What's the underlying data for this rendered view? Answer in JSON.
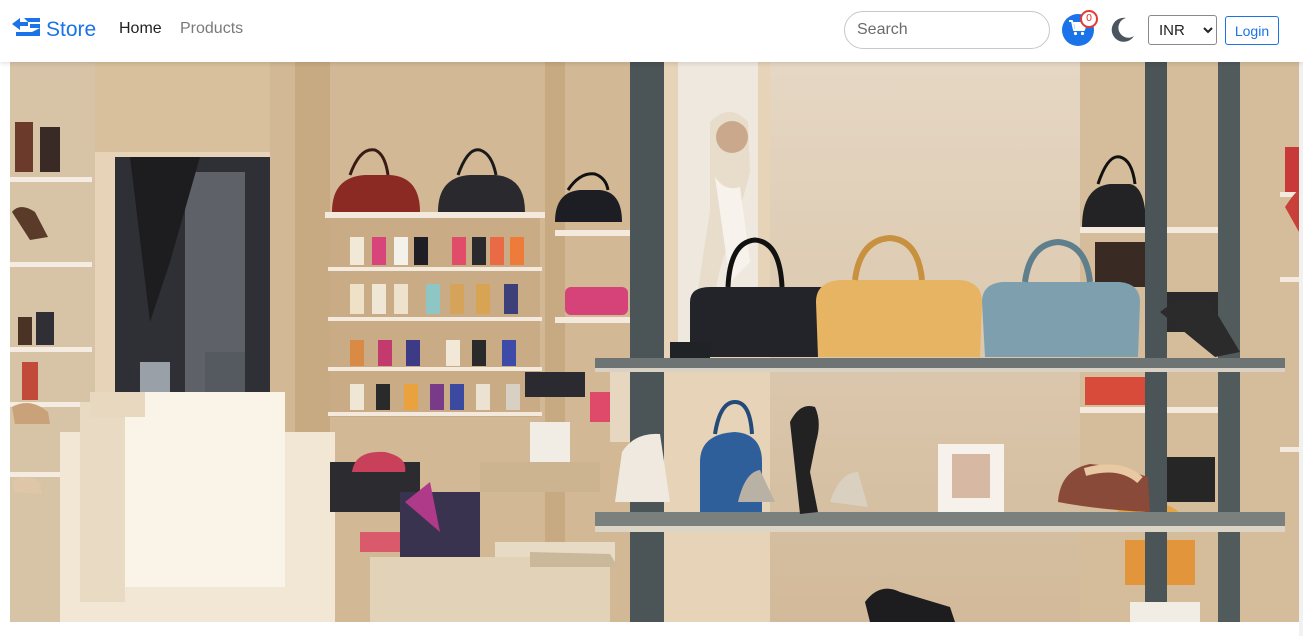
{
  "brand": {
    "name": "Store",
    "icon": "store-logo-icon",
    "color": "#1a73e8"
  },
  "nav": {
    "items": [
      {
        "label": "Home"
      },
      {
        "label": "Products"
      }
    ]
  },
  "search": {
    "placeholder": "Search",
    "value": ""
  },
  "cart": {
    "icon": "cart-icon",
    "count": "0",
    "badge_color": "#e53935"
  },
  "theme_toggle": {
    "icon": "moon-icon"
  },
  "currency": {
    "selected": "INR",
    "options": [
      "INR"
    ]
  },
  "login": {
    "label": "Login"
  },
  "hero": {
    "image": "boutique-store-interior-handbags-shoes"
  },
  "colors": {
    "accent": "#1a73e8",
    "navbar_bg": "#ffffff"
  }
}
